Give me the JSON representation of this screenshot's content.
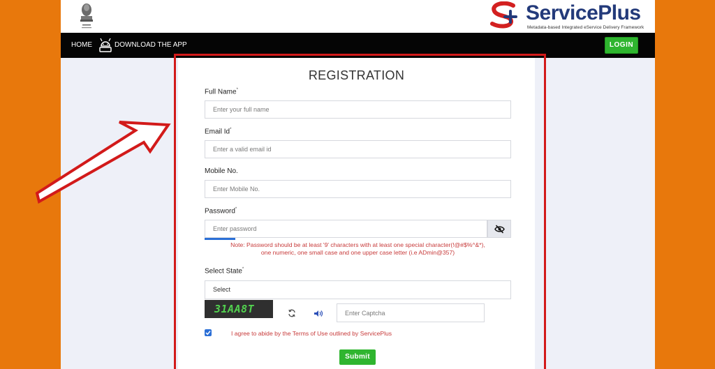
{
  "header": {
    "brand": "ServicePlus",
    "tagline": "Metadata-based Integrated eService Delivery Framework"
  },
  "nav": {
    "home": "HOME",
    "download_app": "DOWNLOAD THE APP",
    "login": "LOGIN"
  },
  "form": {
    "title": "REGISTRATION",
    "full_name": {
      "label": "Full Name",
      "required": "*",
      "placeholder": "Enter your full name"
    },
    "email": {
      "label": "Email Id",
      "required": "*",
      "placeholder": "Enter a valid email id"
    },
    "mobile": {
      "label": "Mobile No.",
      "placeholder": "Enter Mobile No."
    },
    "password": {
      "label": "Password",
      "required": "*",
      "placeholder": "Enter password",
      "note_line1": "Note: Password should be at least '9' characters with at least one special character(!@#$%^&*),",
      "note_line2": "one numeric, one small case and one upper case letter (i.e ADmin@357)"
    },
    "state": {
      "label": "Select State",
      "required": "*",
      "value": "Select"
    },
    "captcha": {
      "code": "31AA8T",
      "placeholder": "Enter Captcha"
    },
    "agree_text": "I agree to abide by the Terms of Use outlined by ServicePlus",
    "submit": "Submit"
  },
  "colors": {
    "page_background": "#e8780c",
    "navbar": "#050505",
    "button_green": "#2fb52f",
    "highlight_red": "#d21a1a",
    "note_red": "#c73a3a",
    "brand_blue": "#233a7a"
  }
}
